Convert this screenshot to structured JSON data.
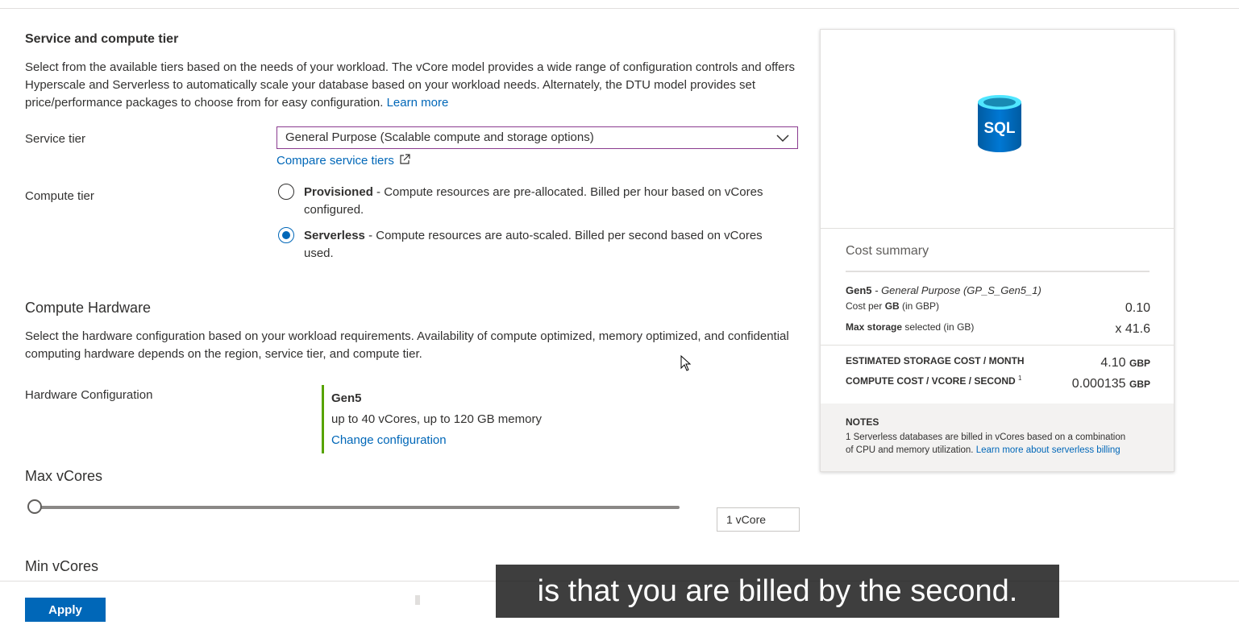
{
  "service_section": {
    "title": "Service and compute tier",
    "description": "Select from the available tiers based on the needs of your workload. The vCore model provides a wide range of configuration controls and offers Hyperscale and Serverless to automatically scale your database based on your workload needs. Alternately, the DTU model provides set price/performance packages to choose from for easy configuration.",
    "learn_more": "Learn more",
    "service_tier_label": "Service tier",
    "service_tier_value": "General Purpose (Scalable compute and storage options)",
    "compare_link": "Compare service tiers",
    "compute_tier_label": "Compute tier",
    "options": [
      {
        "name": "Provisioned",
        "text": " - Compute resources are pre-allocated. Billed per hour based on vCores configured.",
        "selected": false
      },
      {
        "name": "Serverless",
        "text": " - Compute resources are auto-scaled. Billed per second based on vCores used.",
        "selected": true
      }
    ]
  },
  "hardware_section": {
    "title": "Compute Hardware",
    "description": "Select the hardware configuration based on your workload requirements. Availability of compute optimized, memory optimized, and confidential computing hardware depends on the region, service tier, and compute tier.",
    "config_label": "Hardware Configuration",
    "gen": "Gen5",
    "spec": "up to 40 vCores, up to 120 GB memory",
    "change_link": "Change configuration"
  },
  "vcores": {
    "max_label": "Max vCores",
    "max_value": "1 vCore",
    "min_label": "Min vCores"
  },
  "cost_summary": {
    "title": "Cost summary",
    "gen": "Gen5",
    "gen_desc": " - General Purpose (GP_S_Gen5_1)",
    "cost_per_gb_pre": "Cost per ",
    "cost_per_gb_bold": "GB",
    "cost_per_gb_post": " (in GBP)",
    "cost_per_gb_value": "0.10",
    "max_storage_bold": "Max storage",
    "max_storage_post": " selected (in GB)",
    "max_storage_value": "x 41.6",
    "storage_cost_label": "ESTIMATED STORAGE COST / MONTH",
    "storage_cost_value": "4.10",
    "compute_cost_label": "COMPUTE COST / VCORE / SECOND",
    "compute_cost_sup": "1",
    "compute_cost_value": "0.000135",
    "currency": "GBP",
    "notes_title": "NOTES",
    "notes_line1": "1 Serverless databases are billed in vCores based on a combination",
    "notes_line2": "of CPU and memory utilization.",
    "notes_link": "Learn more about serverless billing"
  },
  "logo_text": "SQL",
  "footer": {
    "apply": "Apply"
  },
  "caption": "is that you are billed by the second.",
  "colors": {
    "accent": "#0067b8",
    "hardware_bar": "#57a300",
    "select_border": "#8a3b8f"
  }
}
